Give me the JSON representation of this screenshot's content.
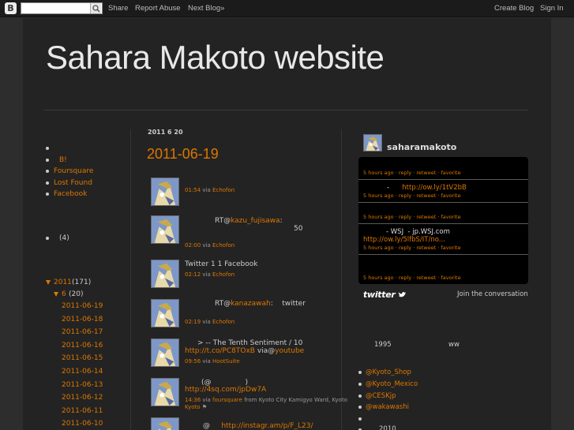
{
  "navbar": {
    "logo": "B",
    "links": [
      "Share",
      "Report Abuse",
      "Next Blog»"
    ],
    "right_links": [
      "Create Blog",
      "Sign In"
    ]
  },
  "blog": {
    "title": "Sahara Makoto website"
  },
  "left_sidebar": {
    "links": [
      "B!",
      "Foursquare",
      "Lost Found",
      "Facebook"
    ],
    "count_label": "(4)",
    "archive": {
      "year": "2011",
      "year_count": "(171)",
      "month": "6",
      "month_count": "(20)",
      "days": [
        "2011-06-19",
        "2011-06-18",
        "2011-06-17",
        "2011-06-16",
        "2011-06-15",
        "2011-06-14",
        "2011-06-13",
        "2011-06-12",
        "2011-06-11",
        "2011-06-10"
      ]
    }
  },
  "main": {
    "date_header": "2011 6 20",
    "post_title": "2011-06-19",
    "tweets": [
      {
        "lines": [],
        "time": "01:54",
        "via": "via",
        "client": "Echofon",
        "extra": ""
      },
      {
        "lines": [
          "RT@",
          "kazu_fujisawa",
          ":",
          "50"
        ],
        "time": "02:00",
        "via": "via",
        "client": "Echofon",
        "extra": ""
      },
      {
        "lines": [
          "Twitter 1 1  Facebook"
        ],
        "time": "02:12",
        "via": "via",
        "client": "Echofon",
        "extra": ""
      },
      {
        "lines": [
          "RT@",
          "kanazawah",
          ":",
          "twitter"
        ],
        "time": "02:19",
        "via": "via",
        "client": "Echofon",
        "extra": ""
      },
      {
        "lines": [
          "> -- The Tenth Sentiment / 10",
          "http://t.co/PC8TOxB",
          " via@",
          "youtube"
        ],
        "time": "09:56",
        "via": "via",
        "client": "HootSuite",
        "extra": ""
      },
      {
        "lines": [
          "(@",
          ")",
          "http://4sq.com/jpDw7A"
        ],
        "time": "14:36",
        "via": "via",
        "client": "foursquare",
        "extra": "from Kyoto City Kamigyo Ward, Kyoto"
      },
      {
        "lines": [
          "@",
          "http://instagr.am/p/F_L23/"
        ],
        "time": "",
        "via": "",
        "client": "",
        "extra": ""
      }
    ]
  },
  "right_sidebar": {
    "username": "saharamakoto",
    "tweet_meta": "5 hours ago · reply · retweet · favorite",
    "tweet_text_1": [
      "-",
      "http://ow.ly/1tV2bB"
    ],
    "tweet_text_2": [
      "- WSJ",
      "- jp.WSJ.com",
      "http://ow.ly/5lfbS/IT/no..."
    ],
    "twitter_logo": "twitter",
    "join_label": "Join the conversation",
    "year_text": "1995",
    "ww_text": "ww",
    "links": [
      "@Kyoto_Shop",
      "@Kyoto_Mexico",
      "@CESKjp",
      "@wakawashi"
    ],
    "bottom_text": "2010"
  },
  "colors": {
    "accent": "#dd7700",
    "background": "#2d2d2d",
    "panel": "#232323"
  }
}
